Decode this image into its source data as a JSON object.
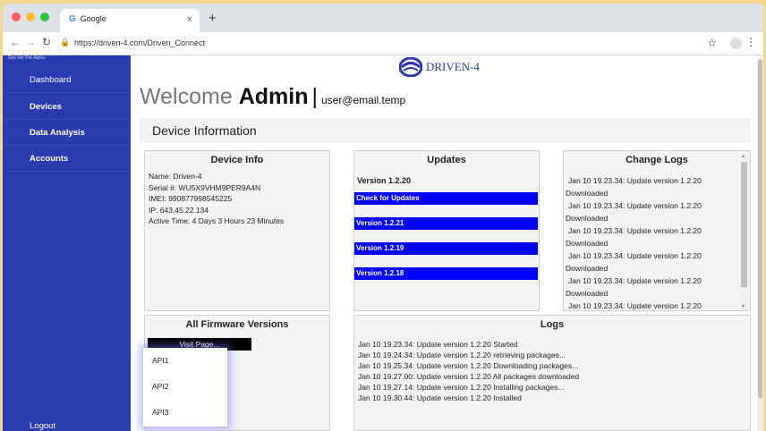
{
  "browser": {
    "tab_title": "Google",
    "tab_icon": "G",
    "url": "https://driven-4.com/Driven_Connect"
  },
  "sidebar": {
    "version": "Dev Ver Pre Alpha",
    "items": [
      {
        "label": "Dashboard"
      },
      {
        "label": "Devices"
      },
      {
        "label": "Data Analysis"
      },
      {
        "label": "Accounts"
      }
    ],
    "logout": "Logout"
  },
  "header": {
    "logo_text": "DRIVEN-4",
    "welcome": "Welcome",
    "user": "Admin",
    "separator": "|",
    "email": "user@email.temp"
  },
  "section_title": "Device Information",
  "device_info": {
    "title": "Device Info",
    "lines": [
      "Name: Driven-4",
      "Serial #: WU5X9VHM9PER9A4N",
      "IMEI: 990877998545225",
      "IP: 643.45.22.134",
      "Active Time: 4 Days 3 Hours 23 Minutes"
    ]
  },
  "updates": {
    "title": "Updates",
    "current_version": "Version 1.2.20",
    "buttons": [
      "Check for Updates",
      "Version 1.2.21",
      "Version 1.2.19",
      "Version 1.2.18"
    ]
  },
  "change_logs": {
    "title": "Change Logs",
    "entries": [
      "Jan 10 19.23.34: Update version 1.2.20",
      "Downloaded",
      "Jan 10 19.23.34: Update version 1.2.20",
      "Downloaded",
      "Jan 10 19.23.34: Update version 1.2.20",
      "Downloaded",
      "Jan 10 19.23.34: Update version 1.2.20",
      "Downloaded",
      "Jan 10 19.23.34: Update version 1.2.20",
      "Downloaded",
      "Jan 10 19.23.34: Update version 1.2.20"
    ]
  },
  "firmware": {
    "title": "All Firmware Versions",
    "visit_label": "Visit Page...",
    "options": [
      "API1",
      "API2",
      "API3"
    ]
  },
  "logs": {
    "title": "Logs",
    "entries": [
      "Jan 10 19.23.34: Update version 1.2.20 Started",
      "Jan 10 19.24.34: Update version 1.2.20 retrieving packages...",
      "Jan 10 19.25.34: Update version 1.2.20 Downloading packages...",
      "Jan 10 19.27.00: Update version 1.2.20 All packages downloaded",
      "Jan 10 19.27.14: Update version 1.2.20 Installing packages...",
      "Jan 10 19.30.44: Update version 1.2.20 Installed"
    ]
  },
  "colors": {
    "sidebar": "#2a3bb0",
    "button": "#0000ff",
    "background": "#f3d88e"
  }
}
